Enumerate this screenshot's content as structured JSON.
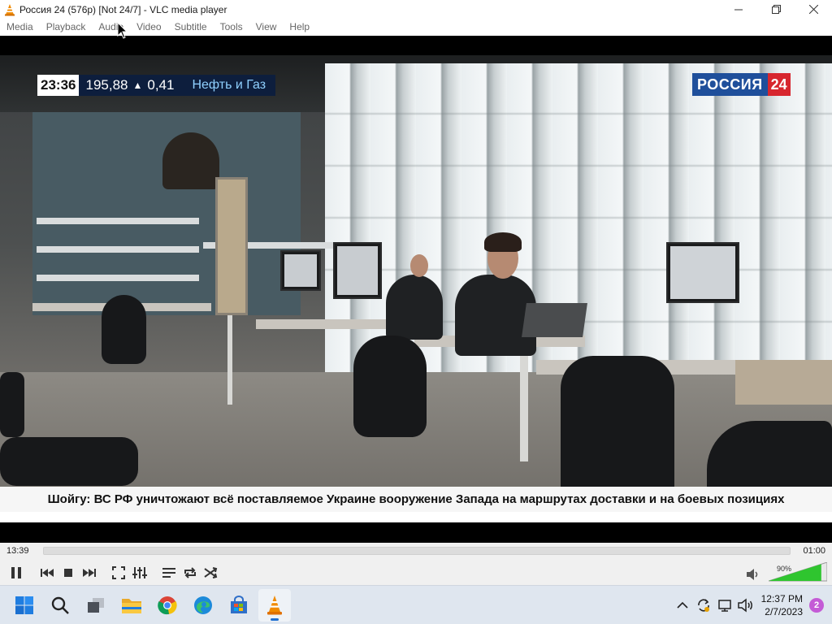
{
  "window": {
    "title": "Россия 24 (576p) [Not 24/7] - VLC media player",
    "icon": "vlc-cone-icon",
    "buttons": [
      "minimize-icon",
      "maximize-icon",
      "close-icon"
    ]
  },
  "menu": {
    "items": [
      "Media",
      "Playback",
      "Audio",
      "Video",
      "Subtitle",
      "Tools",
      "View",
      "Help"
    ]
  },
  "video": {
    "ticker": {
      "time": "23:36",
      "value": "195,88",
      "trend_icon": "up-triangle-icon",
      "change": "0,41",
      "sector": "Нефть и Газ"
    },
    "channel_logo": {
      "name": "РОССИЯ",
      "number": "24"
    },
    "news_caption": "Шойгу: ВС РФ уничтожают всё поставляемое Украине вооружение Запада на маршрутах доставки и на боевых позициях"
  },
  "controls": {
    "elapsed": "13:39",
    "total": "01:00",
    "volume_percent": "90%",
    "volume_level": 0.9,
    "buttons": [
      "pause-icon",
      "previous-icon",
      "stop-icon",
      "next-icon",
      "fullscreen-icon",
      "extended-settings-icon",
      "playlist-icon",
      "loop-icon",
      "shuffle-icon"
    ],
    "speaker_icon": "speaker-icon"
  },
  "taskbar": {
    "apps": [
      "windows-start-icon",
      "search-icon",
      "task-view-icon",
      "file-explorer-icon",
      "chrome-icon",
      "edge-icon",
      "microsoft-store-icon",
      "vlc-icon"
    ],
    "tray": {
      "icons": [
        "chevron-up-icon",
        "sync-icon",
        "network-icon",
        "volume-icon"
      ],
      "time": "12:37 PM",
      "date": "2/7/2023",
      "notification_count": "2"
    }
  },
  "colors": {
    "brand_blue": "#1f4f9b",
    "brand_red": "#d7262e",
    "volume_green": "#2fc52f",
    "vlc_orange": "#f08a00"
  }
}
